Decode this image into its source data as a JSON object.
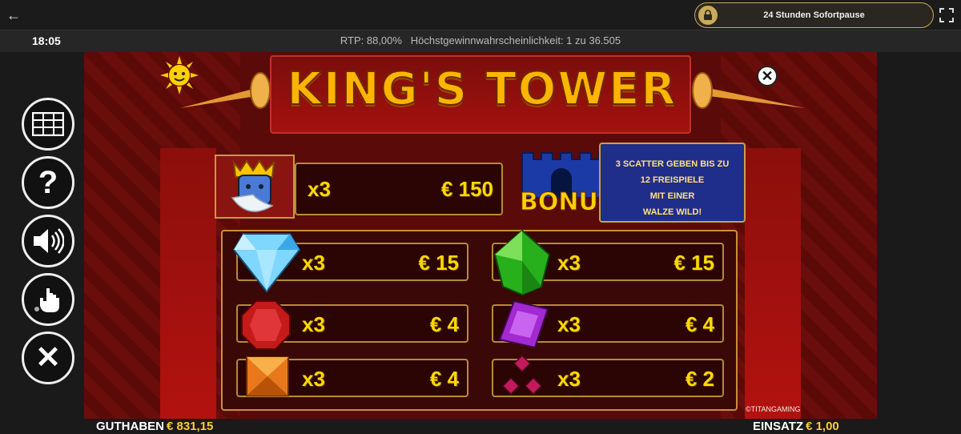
{
  "topbar": {
    "back_icon": "arrow-left-icon",
    "pause_label": "24 Stunden Sofortpause",
    "lock_icon": "lock-icon",
    "fullscreen_icon": "fullscreen-icon"
  },
  "infobar": {
    "clock": "18:05",
    "rtp_text": "RTP: 88,00%   Höchstgewinnwahrscheinlichkeit: 1 zu 36.505"
  },
  "game": {
    "title": "KING'S TOWER",
    "close_icon": "close-icon",
    "king_row": {
      "mult": "x3",
      "amount": "€ 150"
    },
    "bonus": {
      "label": "BONUS",
      "line1": "3 SCATTER GEBEN BIS ZU",
      "line2": "12 FREISPIELE",
      "line3": "MIT EINER",
      "line4": "WALZE WILD!"
    },
    "paytable": [
      {
        "gem": "diamond-icon",
        "mult": "x3",
        "amount": "€ 15"
      },
      {
        "gem": "green-gem-icon",
        "mult": "x3",
        "amount": "€ 15"
      },
      {
        "gem": "red-gem-icon",
        "mult": "x3",
        "amount": "€ 4"
      },
      {
        "gem": "purple-gem-icon",
        "mult": "x3",
        "amount": "€ 4"
      },
      {
        "gem": "orange-gem-icon",
        "mult": "x3",
        "amount": "€ 4"
      },
      {
        "gem": "triple-ruby-icon",
        "mult": "x3",
        "amount": "€ 2"
      }
    ],
    "provider": "©TITANGAMING"
  },
  "side_buttons": [
    {
      "icon": "paytable-grid-icon"
    },
    {
      "icon": "help-icon"
    },
    {
      "icon": "sound-icon"
    },
    {
      "icon": "touch-icon"
    },
    {
      "icon": "close-icon"
    }
  ],
  "bottom": {
    "balance_label": "GUTHABEN",
    "balance_value": "€ 831,15",
    "bet_label": "EINSATZ",
    "bet_value": "€ 1,00"
  },
  "colors": {
    "accent": "#ffd800",
    "panel_border": "#c8903a",
    "background": "#5a0a08"
  }
}
